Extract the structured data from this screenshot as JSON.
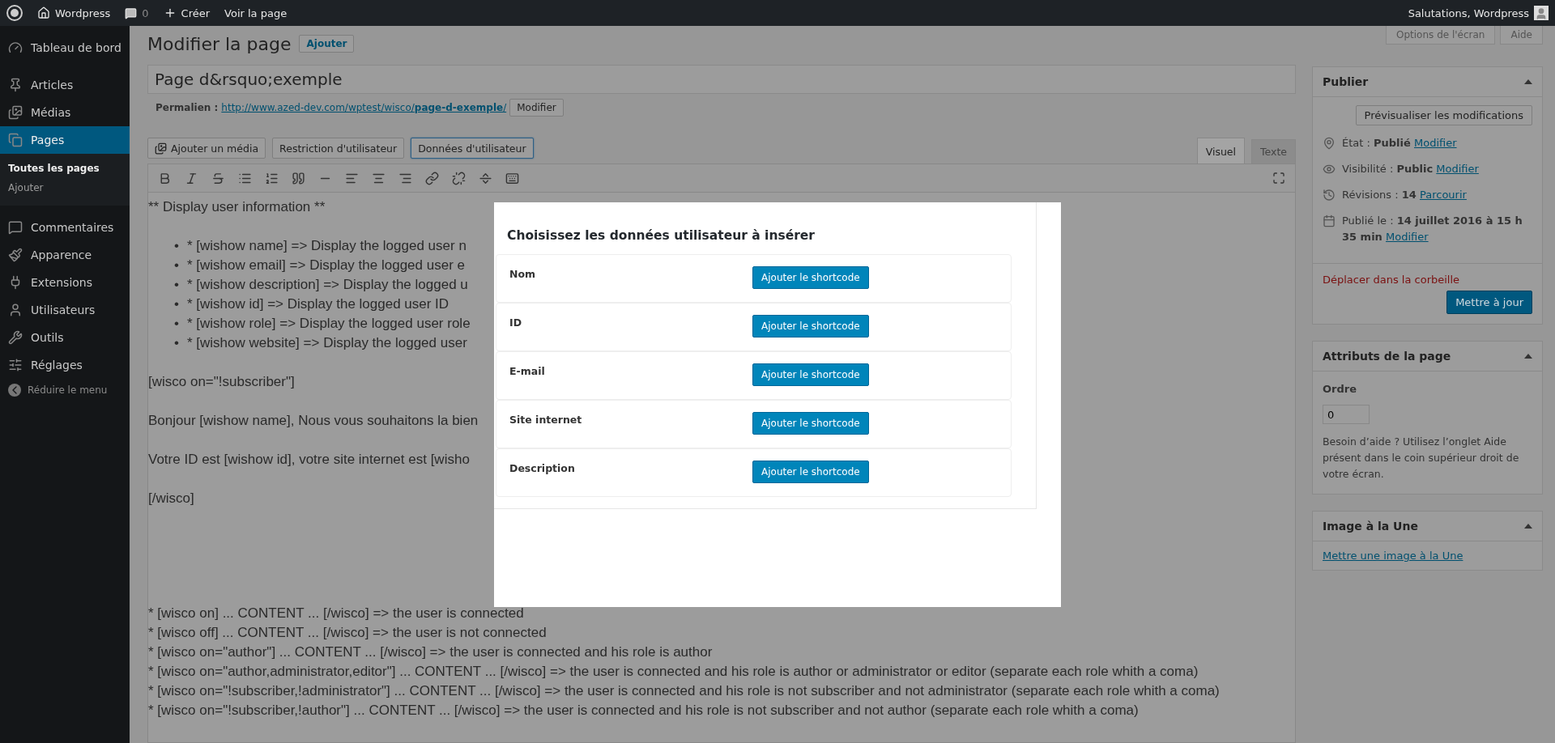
{
  "admin_bar": {
    "site": "Wordpress",
    "comments": "0",
    "new": "Créer",
    "view": "Voir la page",
    "greeting": "Salutations, Wordpress"
  },
  "sidebar": {
    "items": [
      {
        "label": "Tableau de bord",
        "selected": false
      },
      {
        "label": "Articles",
        "selected": false
      },
      {
        "label": "Médias",
        "selected": false
      },
      {
        "label": "Pages",
        "selected": true,
        "children": [
          {
            "label": "Toutes les pages",
            "selected": true
          },
          {
            "label": "Ajouter",
            "selected": false
          }
        ]
      },
      {
        "label": "Commentaires",
        "selected": false
      },
      {
        "label": "Apparence",
        "selected": false
      },
      {
        "label": "Extensions",
        "selected": false
      },
      {
        "label": "Utilisateurs",
        "selected": false
      },
      {
        "label": "Outils",
        "selected": false
      },
      {
        "label": "Réglages",
        "selected": false
      }
    ],
    "collapse": "Réduire le menu"
  },
  "header": {
    "title": "Modifier la page",
    "add_button": "Ajouter",
    "screen_options": "Options de l'écran",
    "help": "Aide"
  },
  "post_title": "Page d&rsquo;exemple",
  "permalink": {
    "label": "Permalien :",
    "url": "http://www.azed-dev.com/wptest/wisco/**page-d-exemple**/",
    "button": "Modifier"
  },
  "media_buttons": [
    {
      "label": "Ajouter un média",
      "selected": false
    },
    {
      "label": "Restriction d'utilisateur",
      "selected": false
    },
    {
      "label": "Données d'utilisateur",
      "selected": true
    }
  ],
  "editor_tabs": [
    {
      "label": "Visuel",
      "selected": true
    },
    {
      "label": "Texte",
      "selected": false
    }
  ],
  "content": [
    {
      "kind": "paragraph",
      "text": "** Display user information **"
    },
    {
      "kind": "bullets",
      "marker": "•",
      "items": [
        "* [wishow name]  => Display the logged user n",
        "* [wishow email]  => Display the logged user e",
        "* [wishow description]  => Display the logged u",
        "* [wishow id]  => Display the logged user ID",
        "* [wishow role]  => Display the logged user role",
        "* [wishow website]  => Display the logged user"
      ]
    },
    {
      "kind": "paragraph",
      "text": "[wisco on=\"!subscriber\"]"
    },
    {
      "kind": "paragraph",
      "text": "Bonjour [wishow name], Nous vous souhaitons la bien"
    },
    {
      "kind": "paragraph",
      "text": "Votre ID est [wishow id], votre site internet est [wisho"
    },
    {
      "kind": "paragraph",
      "text": "[/wisco]"
    },
    {
      "kind": "lines",
      "lines": [
        "* [wisco on] ... CONTENT ... [/wisco]  => the user is connected",
        "* [wisco off] ... CONTENT ... [/wisco]  => the user is not connected",
        "* [wisco on=\"author\"] ... CONTENT ... [/wisco]  => the user is connected and his role is author",
        "* [wisco on=\"author,administrator,editor\"] ... CONTENT ... [/wisco]  => the user is connected and his role is author or administrator or editor (separate each role whith a coma)",
        "* [wisco on=\"!subscriber,!administrator\"] ... CONTENT ... [/wisco]  => the user is connected and his role is not subscriber and not administrator (separate each role whith a coma)",
        "* [wisco on=\"!subscriber,!author\"] ... CONTENT ... [/wisco]  => the user is connected and his role is not subscriber and not author (separate each role whith a coma)"
      ]
    }
  ],
  "modal": {
    "title": "Choisissez les données utilisateur à insérer",
    "rows": [
      {
        "label": "Nom",
        "button": "Ajouter le shortcode"
      },
      {
        "label": "ID",
        "button": "Ajouter le shortcode"
      },
      {
        "label": "E-mail",
        "button": "Ajouter le shortcode"
      },
      {
        "label": "Site internet",
        "button": "Ajouter le shortcode"
      },
      {
        "label": "Description",
        "button": "Ajouter le shortcode"
      }
    ]
  },
  "publish_box": {
    "title": "Publier",
    "preview": "Prévisualiser les modifications",
    "rows": [
      {
        "text": "État : **Publié**",
        "link": "Modifier"
      },
      {
        "text": "Visibilité : **Public**",
        "link": "Modifier"
      },
      {
        "text": "Révisions : **14**",
        "link": "Parcourir"
      },
      {
        "text": "Publié le : **14 juillet 2016 à 15 h 35 min**",
        "link": "Modifier"
      }
    ],
    "trash": "Déplacer dans la corbeille",
    "update": "Mettre à jour"
  },
  "attributes_box": {
    "title": "Attributs de la page",
    "order_label": "Ordre",
    "order_value": "0",
    "help": "Besoin d’aide ? Utilisez l’onglet Aide présent dans le coin supérieur droit de votre écran."
  },
  "featured_box": {
    "title": "Image à la Une",
    "link": "Mettre une image à la Une"
  }
}
